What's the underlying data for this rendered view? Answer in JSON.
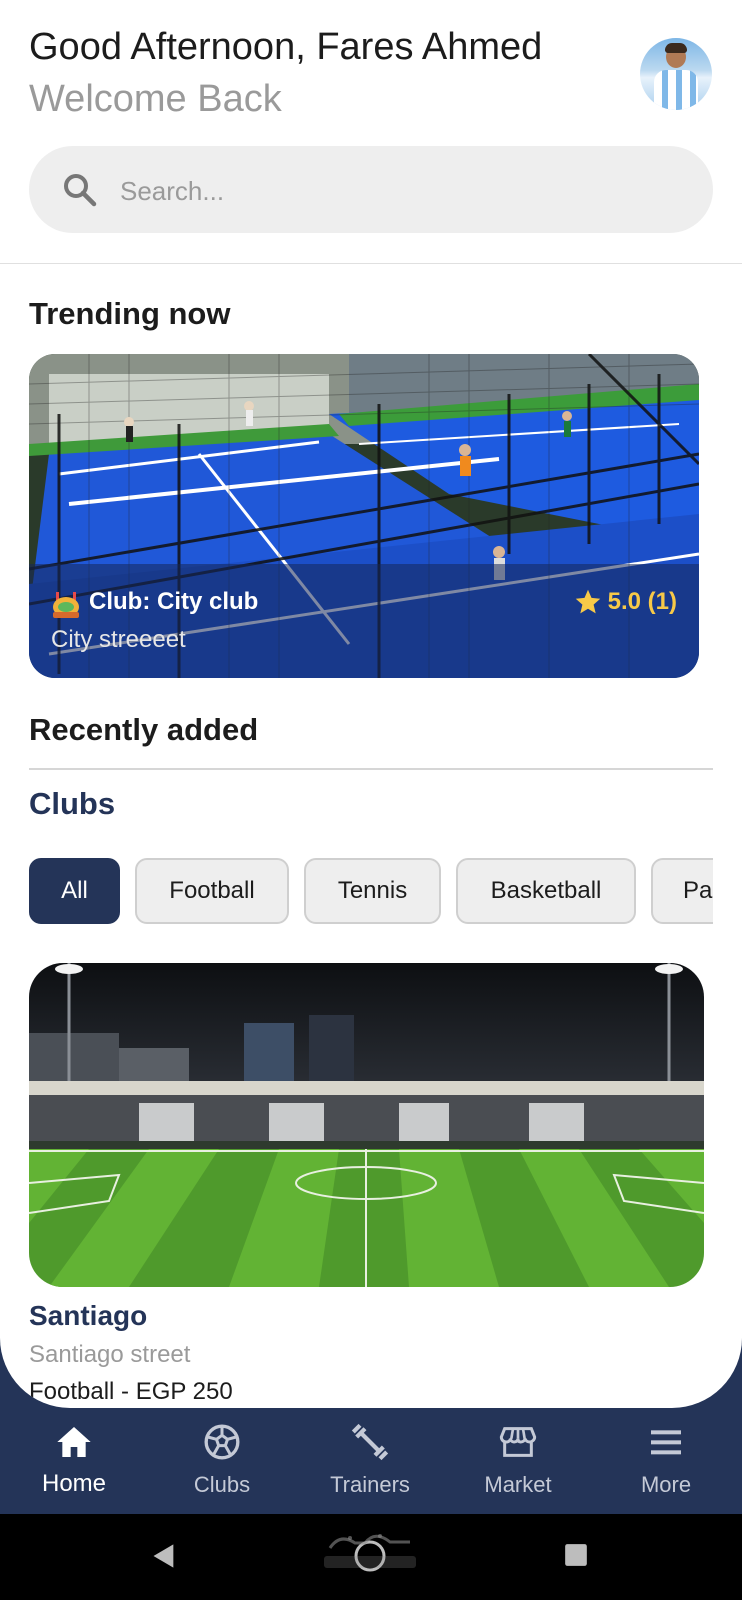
{
  "header": {
    "greeting": "Good Afternoon, Fares Ahmed",
    "subtitle": "Welcome Back"
  },
  "search": {
    "placeholder": "Search..."
  },
  "trending": {
    "title": "Trending now",
    "card": {
      "club_label": "Club: City club",
      "street": "City streeeet",
      "rating": "5.0 (1)"
    }
  },
  "recent": {
    "title": "Recently added",
    "clubs_title": "Clubs",
    "chips": [
      "All",
      "Football",
      "Tennis",
      "Basketball",
      "Pa"
    ],
    "active_chip": "All",
    "club": {
      "name": "Santiago",
      "street": "Santiago street",
      "price": "Football - EGP 250"
    }
  },
  "nav": {
    "items": [
      {
        "label": "Home",
        "icon": "home-icon"
      },
      {
        "label": "Clubs",
        "icon": "soccer-ball-icon"
      },
      {
        "label": "Trainers",
        "icon": "dumbbell-icon"
      },
      {
        "label": "Market",
        "icon": "store-icon"
      },
      {
        "label": "More",
        "icon": "menu-icon"
      }
    ],
    "active": "Home"
  },
  "colors": {
    "primary": "#243458",
    "rating": "#f7c948"
  }
}
